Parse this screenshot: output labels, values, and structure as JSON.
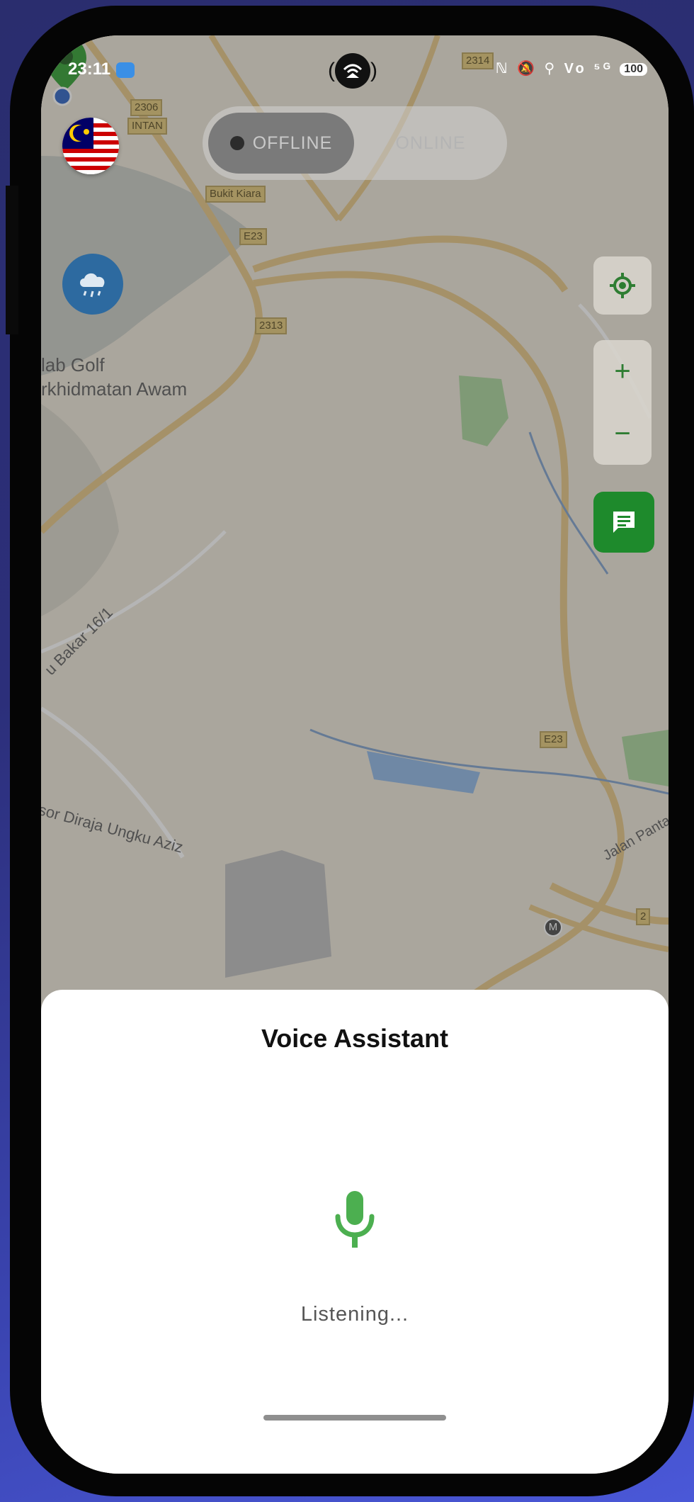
{
  "status_bar": {
    "time": "23:11",
    "right_icons": "ℕ 🔕 ⚲ Vo ⁵ᴳ",
    "battery": "100"
  },
  "map": {
    "labels": {
      "golf_line1": "lab Golf",
      "golf_line2": "rkhidmatan Awam",
      "bukit_kiara": "Bukit Kiara",
      "bakar": "u Bakar 16/1",
      "diraja": "sor Diraja Ungku Aziz",
      "jalan_panta": "Jalan Panta"
    },
    "shields": {
      "s2306": "2306",
      "intan": "INTAN",
      "e23_top": "E23",
      "s2313": "2313",
      "s2314": "2314",
      "e23_right": "E23",
      "s2": "2",
      "metro": "M"
    }
  },
  "toggle": {
    "offline_label": "OFFLINE",
    "online_label": "ONLINE"
  },
  "controls": {
    "zoom_in": "+",
    "zoom_out": "−"
  },
  "sheet": {
    "title": "Voice Assistant",
    "status": "Listening..."
  },
  "colors": {
    "accent_green": "#4caf50",
    "chat_green": "#1e8a2c",
    "pin_green": "#2e9e2e",
    "location_blue": "#2a62c4"
  }
}
